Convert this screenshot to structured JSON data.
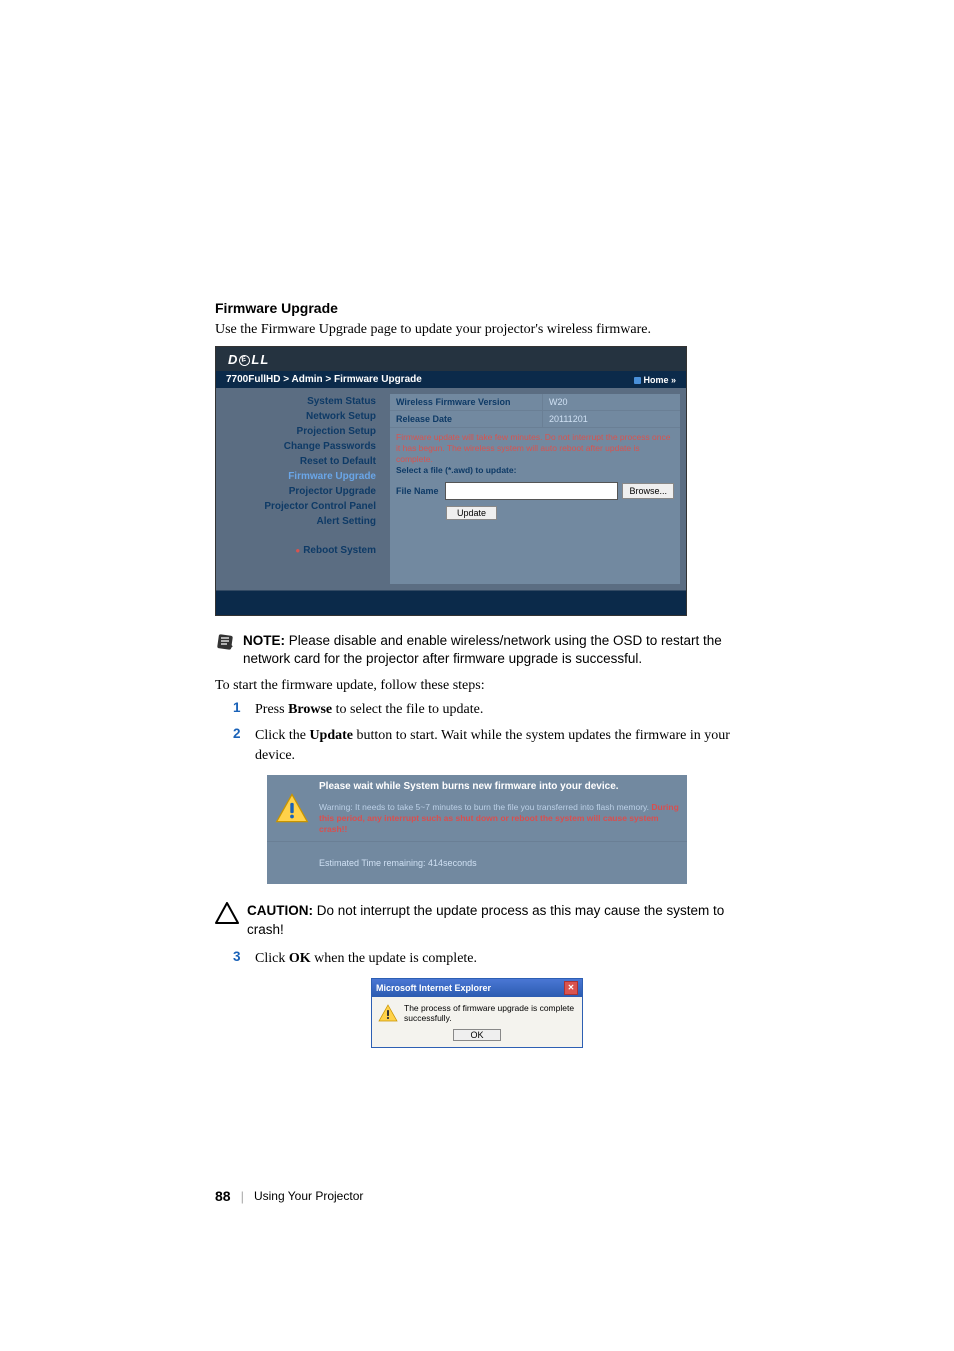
{
  "section_title": "Firmware Upgrade",
  "intro": "Use the Firmware Upgrade page to update your projector's wireless firmware.",
  "admin": {
    "logo": "DELL",
    "breadcrumb": "7700FullHD > Admin > Firmware Upgrade",
    "home": "Home »",
    "sidebar": {
      "items": [
        "System Status",
        "Network Setup",
        "Projection Setup",
        "Change Passwords",
        "Reset to Default",
        "Firmware Upgrade",
        "Projector Upgrade",
        "Projector Control Panel",
        "Alert Setting"
      ],
      "reboot": "Reboot System"
    },
    "rows": {
      "ver_label": "Wireless Firmware Version",
      "ver_value": "W20",
      "date_label": "Release Date",
      "date_value": "20111201"
    },
    "info_line1": "Firmware update will take few minutes. Do not interrupt the process once it has begun. The wireless system will auto reboot after update is complete.",
    "info_line2": "Select a file (*.awd) to update:",
    "file_label": "File Name",
    "browse": "Browse...",
    "update": "Update"
  },
  "note": {
    "label": "NOTE:",
    "text": "Please disable and enable wireless/network using the OSD to restart the network card for the projector after firmware upgrade is successful."
  },
  "steps_intro": "To start the firmware update, follow these steps:",
  "steps": {
    "s1": {
      "num": "1",
      "text_a": "Press ",
      "bold": "Browse",
      "text_b": " to select the file to update."
    },
    "s2": {
      "num": "2",
      "text_a": "Click the ",
      "bold": "Update",
      "text_b": " button to start. Wait while the system updates the firmware in your device."
    },
    "s3": {
      "num": "3",
      "text_a": "Click ",
      "bold": "OK",
      "text_b": " when the update is complete."
    }
  },
  "burn": {
    "line1": "Please wait while System burns new firmware into your device.",
    "line2a": "Warning: It needs to take 5~7 minutes to burn the file you transferred into flash memory.",
    "line2b": "During this period, any interrupt such as shut down or reboot the system will cause system crash!!",
    "bottom": "Estimated Time remaining: 414seconds"
  },
  "caution": {
    "label": "CAUTION:",
    "text": "Do not interrupt the update process as this may cause the system to crash!"
  },
  "dialog": {
    "title": "Microsoft Internet Explorer",
    "msg": "The process of firmware upgrade is complete successfully.",
    "ok": "OK"
  },
  "footer": {
    "page": "88",
    "text": "Using Your Projector"
  }
}
